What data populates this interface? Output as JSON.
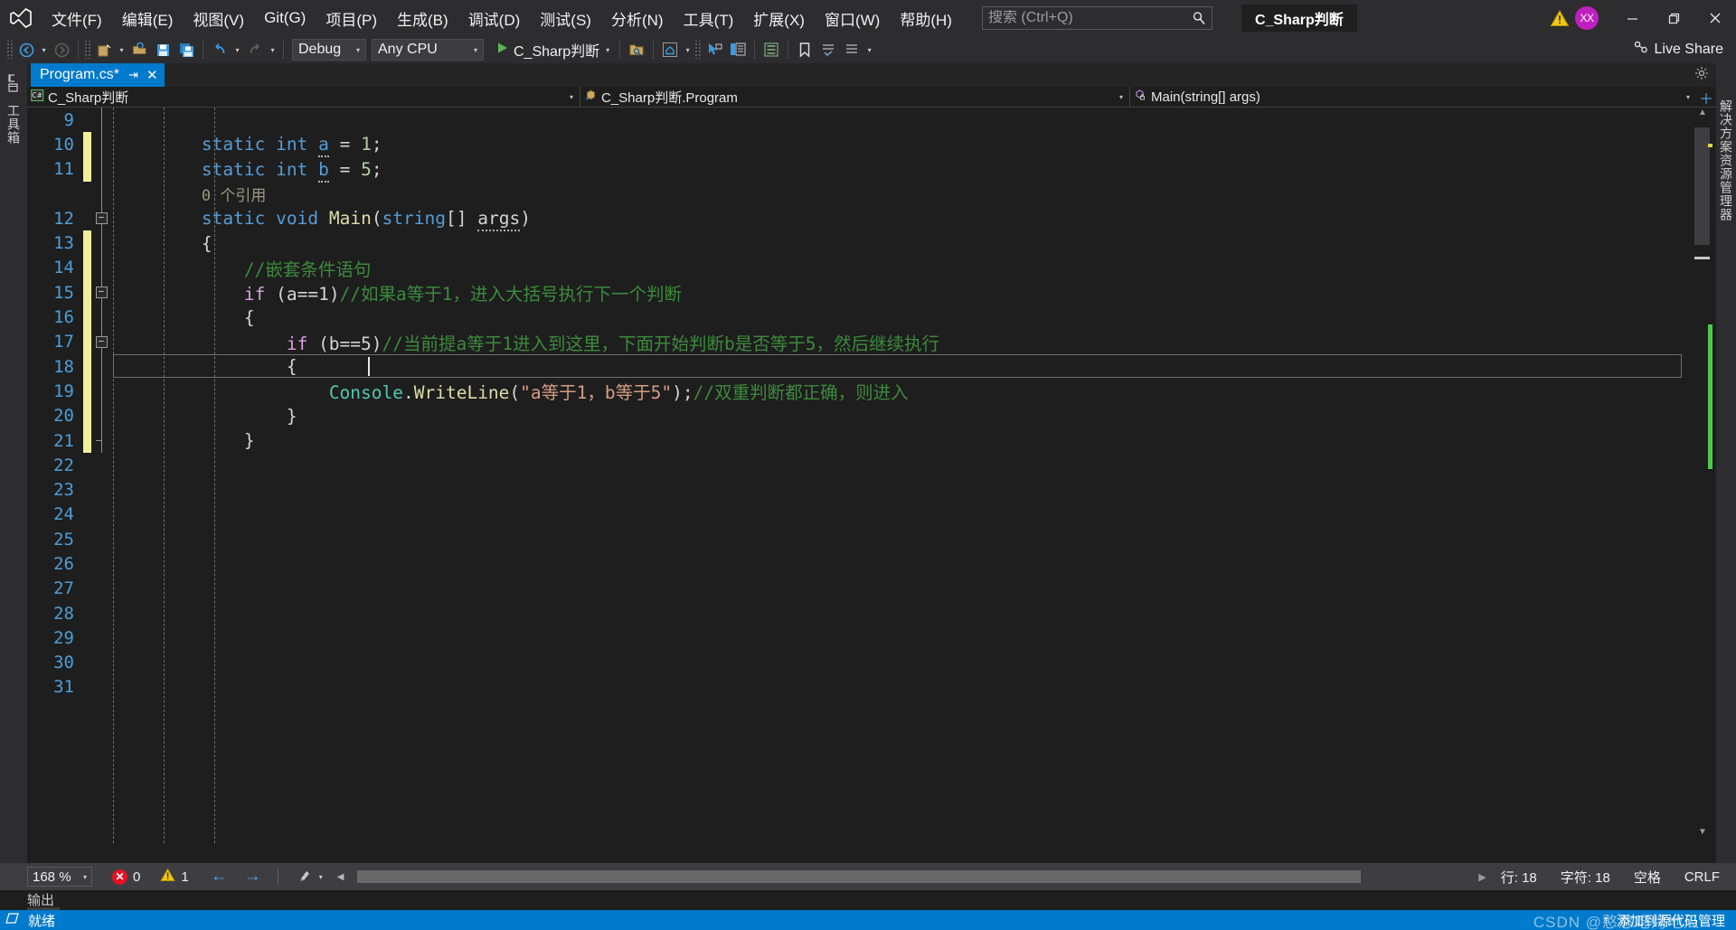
{
  "window": {
    "logo_icon": "visual-studio-logo",
    "solution_chip": "C_Sharp判断",
    "warning_icon": "warning-triangle-icon",
    "avatar_initials": "XX",
    "minimize_icon": "minimize-icon",
    "restore_icon": "restore-icon",
    "close_icon": "close-icon"
  },
  "menu": {
    "items": [
      {
        "label": "文件(F)"
      },
      {
        "label": "编辑(E)"
      },
      {
        "label": "视图(V)"
      },
      {
        "label": "Git(G)"
      },
      {
        "label": "项目(P)"
      },
      {
        "label": "生成(B)"
      },
      {
        "label": "调试(D)"
      },
      {
        "label": "测试(S)"
      },
      {
        "label": "分析(N)"
      },
      {
        "label": "工具(T)"
      },
      {
        "label": "扩展(X)"
      },
      {
        "label": "窗口(W)"
      },
      {
        "label": "帮助(H)"
      }
    ]
  },
  "search": {
    "placeholder": "搜索 (Ctrl+Q)",
    "value": "",
    "icon": "search-icon"
  },
  "toolbar": {
    "back_icon": "navigate-back-icon",
    "forward_icon": "navigate-forward-icon",
    "new_project_icon": "new-project-icon",
    "open_icon": "open-file-icon",
    "save_icon": "save-icon",
    "save_all_icon": "save-all-icon",
    "undo_icon": "undo-icon",
    "redo_icon": "redo-icon",
    "configuration": "Debug",
    "platform": "Any CPU",
    "run_icon": "run-play-icon",
    "run_target": "C_Sharp判断",
    "find_icon": "find-in-files-icon",
    "home_icon": "home-icon",
    "pointer_icon": "select-element-icon",
    "layout_icon": "layout-panel-icon",
    "align_icon": "align-icon",
    "bookmark_icon": "bookmark-icon",
    "comment_icon": "comment-icon",
    "uncomment_icon": "uncomment-icon",
    "live_share_label": "Live Share",
    "live_share_icon": "live-share-icon"
  },
  "rails": {
    "left_label": "工具箱",
    "right_label": "解决方案资源管理器"
  },
  "tabs": {
    "items": [
      {
        "label": "Program.cs*",
        "pin_icon": "pin-icon",
        "close_icon": "close-icon",
        "active": true
      }
    ],
    "gear_icon": "gear-icon"
  },
  "navbar": {
    "project": {
      "label": "C_Sharp判断",
      "icon": "csharp-project-icon"
    },
    "type": {
      "label": "C_Sharp判断.Program",
      "icon": "class-icon"
    },
    "member": {
      "label": "Main(string[] args)",
      "icon": "method-private-icon"
    },
    "add_icon": "add-icon"
  },
  "editor": {
    "first_visible_line": 9,
    "code_lines": [
      {
        "num": "9",
        "indent": 0,
        "changed": false,
        "text": ""
      },
      {
        "num": "10",
        "indent": 0,
        "changed": true,
        "text": "        static int a = 1;"
      },
      {
        "num": "11",
        "indent": 0,
        "changed": true,
        "text": "        static int b = 5;"
      },
      {
        "num": "",
        "indent": 0,
        "changed": false,
        "text": "        0 个引用",
        "codelens": true
      },
      {
        "num": "12",
        "indent": 0,
        "changed": false,
        "text": "        static void Main(string[] args)",
        "fold": "minus"
      },
      {
        "num": "13",
        "indent": 0,
        "changed": true,
        "text": "        {"
      },
      {
        "num": "14",
        "indent": 0,
        "changed": true,
        "text": "            //嵌套条件语句"
      },
      {
        "num": "15",
        "indent": 0,
        "changed": true,
        "text": "            if (a==1)//如果a等于1，进入大括号执行下一个判断",
        "fold": "minus"
      },
      {
        "num": "16",
        "indent": 0,
        "changed": true,
        "text": "            {"
      },
      {
        "num": "17",
        "indent": 0,
        "changed": true,
        "text": "                if (b==5)//当前提a等于1进入到这里，下面开始判断b是否等于5，然后继续执行",
        "fold": "minus"
      },
      {
        "num": "18",
        "indent": 0,
        "changed": true,
        "text": "                {",
        "current": true
      },
      {
        "num": "19",
        "indent": 0,
        "changed": true,
        "text": "                    Console.WriteLine(\"a等于1，b等于5\");//双重判断都正确，则进入"
      },
      {
        "num": "20",
        "indent": 0,
        "changed": true,
        "text": "                }"
      },
      {
        "num": "21",
        "indent": 0,
        "changed": true,
        "text": "            }"
      },
      {
        "num": "22",
        "indent": 0,
        "changed": false,
        "text": ""
      },
      {
        "num": "23",
        "indent": 0,
        "changed": false,
        "text": ""
      },
      {
        "num": "24",
        "indent": 0,
        "changed": false,
        "text": ""
      },
      {
        "num": "25",
        "indent": 0,
        "changed": false,
        "text": ""
      },
      {
        "num": "26",
        "indent": 0,
        "changed": false,
        "text": ""
      },
      {
        "num": "27",
        "indent": 0,
        "changed": false,
        "text": ""
      },
      {
        "num": "28",
        "indent": 0,
        "changed": false,
        "text": ""
      },
      {
        "num": "29",
        "indent": 0,
        "changed": false,
        "text": ""
      },
      {
        "num": "30",
        "indent": 0,
        "changed": false,
        "text": ""
      },
      {
        "num": "31",
        "indent": 0,
        "changed": false,
        "text": ""
      }
    ],
    "tokens": {
      "l10": [
        {
          "t": "        ",
          "c": "pun"
        },
        {
          "t": "static",
          "c": "kw"
        },
        {
          "t": " ",
          "c": "pun"
        },
        {
          "t": "int",
          "c": "kw"
        },
        {
          "t": " ",
          "c": "pun"
        },
        {
          "t": "a",
          "c": "sq"
        },
        {
          "t": " = ",
          "c": "pun"
        },
        {
          "t": "1",
          "c": "num"
        },
        {
          "t": ";",
          "c": "pun"
        }
      ],
      "l11": [
        {
          "t": "        ",
          "c": "pun"
        },
        {
          "t": "static",
          "c": "kw"
        },
        {
          "t": " ",
          "c": "pun"
        },
        {
          "t": "int",
          "c": "kw"
        },
        {
          "t": " ",
          "c": "pun"
        },
        {
          "t": "b",
          "c": "sq"
        },
        {
          "t": " = ",
          "c": "pun"
        },
        {
          "t": "5",
          "c": "num"
        },
        {
          "t": ";",
          "c": "pun"
        }
      ],
      "codelens": "0 个引用",
      "l12": [
        {
          "t": "        ",
          "c": "pun"
        },
        {
          "t": "static",
          "c": "kw"
        },
        {
          "t": " ",
          "c": "pun"
        },
        {
          "t": "void",
          "c": "kw"
        },
        {
          "t": " ",
          "c": "pun"
        },
        {
          "t": "Main",
          "c": "mth"
        },
        {
          "t": "(",
          "c": "pun"
        },
        {
          "t": "string",
          "c": "kw"
        },
        {
          "t": "[] ",
          "c": "pun"
        },
        {
          "t": "args",
          "c": "sq"
        },
        {
          "t": ")",
          "c": "pun"
        }
      ],
      "l13": "        {",
      "l14": "            //嵌套条件语句",
      "l15_kw": "if",
      "l15_cond": " (a==1)",
      "l15_cmt": "//如果a等于1，进入大括号执行下一个判断",
      "l16": "            {",
      "l17_kw": "if",
      "l17_cond": " (b==5)",
      "l17_cmt": "//当前提a等于1进入到这里，下面开始判断b是否等于5，然后继续执行",
      "l18": "                {",
      "l19_cls": "Console",
      "l19_dot": ".",
      "l19_mth": "WriteLine",
      "l19_open": "(",
      "l19_str": "\"a等于1，b等于5\"",
      "l19_close": ");",
      "l19_cmt": "//双重判断都正确，则进入",
      "l20": "                }",
      "l21": "            }"
    }
  },
  "editor_status": {
    "zoom": "168 %",
    "error_count": "0",
    "warning_count": "1",
    "error_icon": "error-circle-icon",
    "warning_icon": "warning-triangle-icon",
    "prev_icon": "arrow-left-icon",
    "next_icon": "arrow-right-icon",
    "brush_icon": "brush-icon",
    "line_label": "行: 18",
    "char_label": "字符: 18",
    "spaces_label": "空格",
    "eol_label": "CRLF"
  },
  "output": {
    "tab_label": "输出"
  },
  "taskbar": {
    "ready_icon": "ready-icon",
    "ready_label": "就绪",
    "source_control_icon": "arrow-up-icon",
    "source_control_label": "添加到源代码管理",
    "watermark": "CSDN @憨憨吃烤地瓜"
  }
}
